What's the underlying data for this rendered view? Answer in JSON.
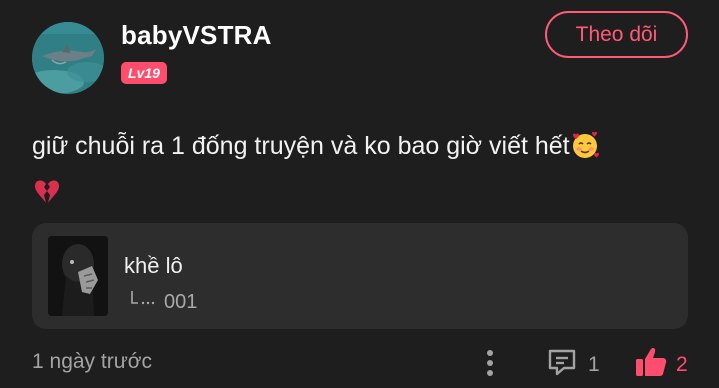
{
  "author": {
    "username": "babyVSTRA",
    "level": "Lv19"
  },
  "follow_label": "Theo dõi",
  "post": {
    "text": "giữ chuỗi ra 1 đống truyện và ko bao giờ viết hết",
    "emojis": [
      "smiling-face-with-hearts",
      "broken-heart"
    ]
  },
  "story": {
    "title": "khề lô",
    "chapter": "001"
  },
  "footer": {
    "timestamp": "1 ngày trước",
    "comment_count": "1",
    "like_count": "2"
  },
  "colors": {
    "background": "#1e1e1e",
    "card": "#2d2d2d",
    "accent": "#ff4d6d",
    "muted_text": "#a3a3a3"
  }
}
